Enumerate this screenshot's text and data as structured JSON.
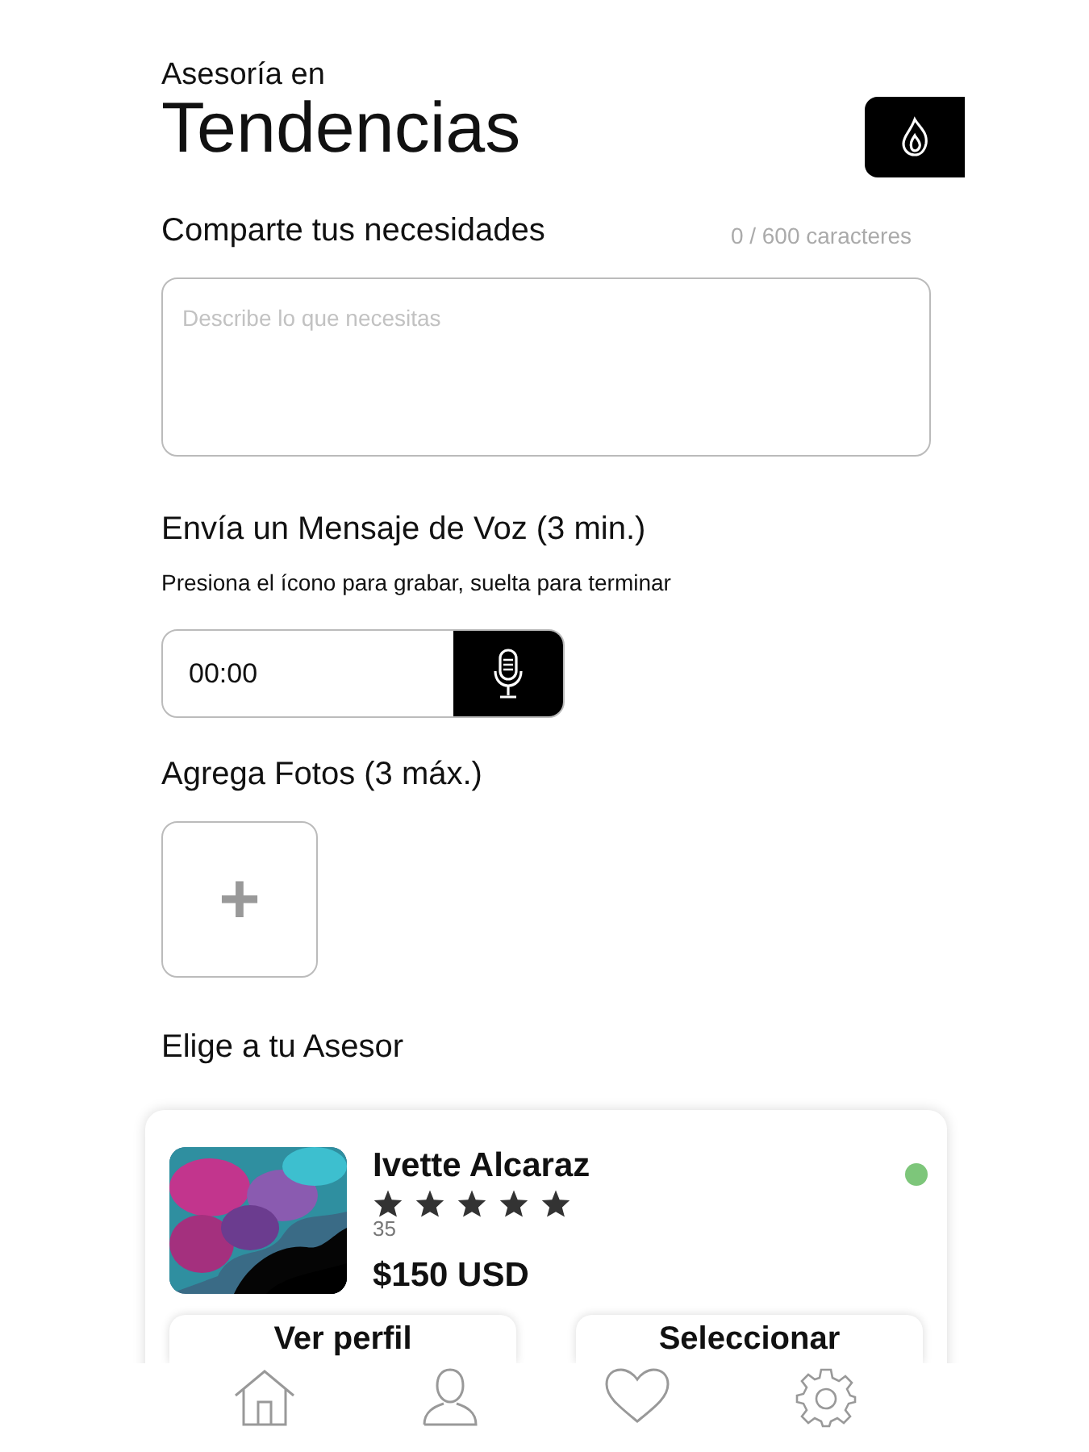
{
  "header": {
    "subtitle": "Asesoría en",
    "title": "Tendencias"
  },
  "needs": {
    "label": "Comparte tus necesidades",
    "counter": "0 / 600 caracteres",
    "placeholder": "Describe lo que necesitas"
  },
  "voice": {
    "label": "Envía un Mensaje de Voz (3 min.)",
    "hint": "Presiona el ícono para grabar, suelta para terminar",
    "time": "00:00"
  },
  "photos": {
    "label": "Agrega Fotos (3 máx.)",
    "add": "+"
  },
  "advisors": {
    "label": "Elige a tu Asesor",
    "items": [
      {
        "name": "Ivette Alcaraz",
        "stars": 5,
        "reviews": "35",
        "price": "$150 USD",
        "color": "#7dc67a",
        "buttons": [
          "Ver perfil",
          "Seleccionar"
        ]
      }
    ]
  },
  "tab_bar": [
    {
      "kind": "home"
    },
    {
      "kind": "profile"
    },
    {
      "kind": "favorites"
    },
    {
      "kind": "settings"
    }
  ]
}
